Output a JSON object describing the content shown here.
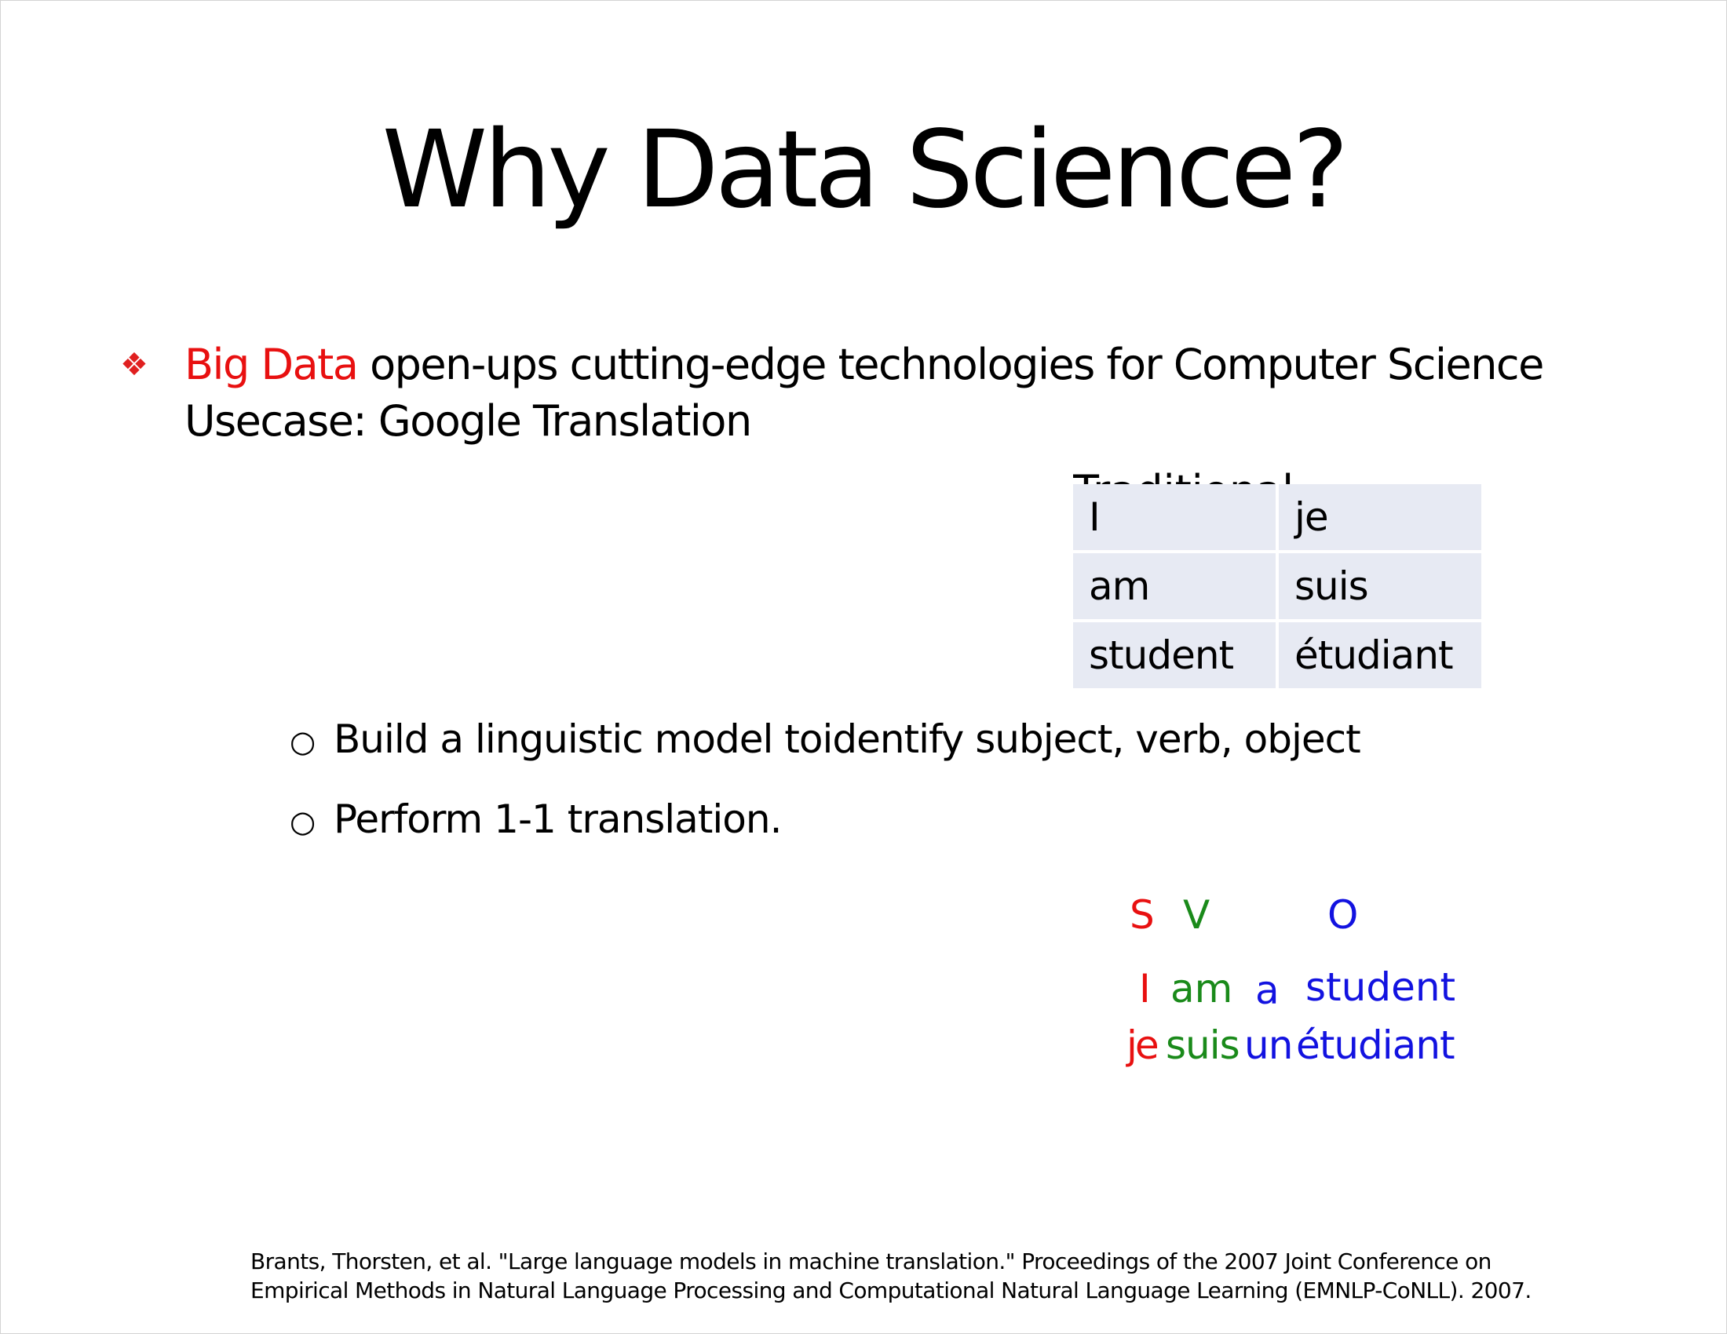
{
  "slide": {
    "title": "Why Data Science?",
    "bullet_icon": "diamond-bullet-icon",
    "bullet": {
      "highlight": "Big Data",
      "rest": " open-ups cutting-edge technologies for Computer Science",
      "line2": "Usecase: Google Translation"
    },
    "partially_hidden_text": "Traditional approach",
    "dictionary_table": [
      [
        "I",
        "je"
      ],
      [
        "am",
        "suis"
      ],
      [
        "student",
        "étudiant"
      ]
    ],
    "sub_bullets": [
      "Build a linguistic model toidentify subject, verb, object",
      "Perform 1-1 translation."
    ],
    "svo": {
      "labels": [
        "S",
        "V",
        "O"
      ],
      "english": [
        "I",
        "am",
        "a",
        "student"
      ],
      "french": [
        "je",
        "suis",
        "un",
        "étudiant"
      ]
    },
    "citation": {
      "line1": "Brants, Thorsten, et al. \"Large language models in machine translation.\" Proceedings of the 2007 Joint Conference on",
      "line2": "Empirical Methods in Natural Language Processing and Computational Natural Language Learning (EMNLP-CoNLL). 2007."
    },
    "colors": {
      "subject": "#e81010",
      "verb": "#1a8a1a",
      "object": "#1212e0",
      "table_cell": "#e7eaf3"
    }
  }
}
